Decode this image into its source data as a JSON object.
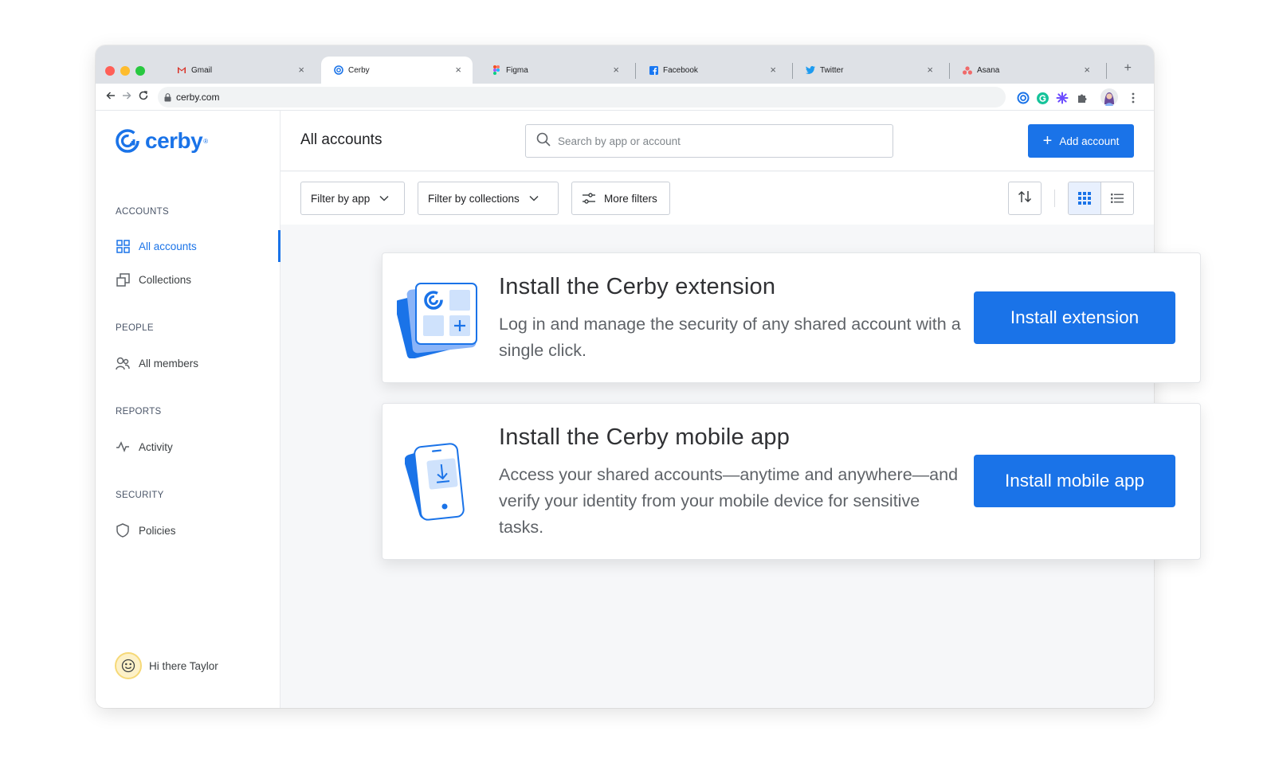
{
  "browser": {
    "tabs": [
      {
        "label": "Gmail",
        "icon": "gmail-icon"
      },
      {
        "label": "Cerby",
        "icon": "cerby-icon",
        "active": true
      },
      {
        "label": "Figma",
        "icon": "figma-icon"
      },
      {
        "label": "Facebook",
        "icon": "facebook-icon"
      },
      {
        "label": "Twitter",
        "icon": "twitter-icon"
      },
      {
        "label": "Asana",
        "icon": "asana-icon"
      }
    ],
    "tab_close": "×",
    "new_tab": "+",
    "url": "cerby.com"
  },
  "brand": {
    "name": "cerby",
    "reg": "®",
    "color": "#1a73e8"
  },
  "sidebar": {
    "sections": [
      {
        "title": "ACCOUNTS",
        "items": [
          {
            "label": "All accounts",
            "icon": "grid-icon",
            "active": true
          },
          {
            "label": "Collections",
            "icon": "collections-icon"
          }
        ]
      },
      {
        "title": "PEOPLE",
        "items": [
          {
            "label": "All members",
            "icon": "members-icon"
          }
        ]
      },
      {
        "title": "REPORTS",
        "items": [
          {
            "label": "Activity",
            "icon": "activity-icon"
          }
        ]
      },
      {
        "title": "SECURITY",
        "items": [
          {
            "label": "Policies",
            "icon": "shield-icon"
          }
        ]
      }
    ],
    "user_greeting": "Hi there Taylor"
  },
  "header": {
    "title": "All accounts",
    "search_placeholder": "Search by app or account",
    "add_button": "Add account"
  },
  "filters": {
    "filter_app": "Filter by app",
    "filter_collections": "Filter by collections",
    "more_filters": "More filters",
    "view_mode": "grid"
  },
  "cards": {
    "extension": {
      "title": "Install the Cerby extension",
      "body": "Log in and manage the security of any shared account with a single click.",
      "button": "Install extension"
    },
    "mobile": {
      "title": "Install the Cerby mobile app",
      "body": "Access your shared accounts—anytime and anywhere—and verify your identity from your mobile device for sensitive tasks.",
      "button": "Install mobile app"
    }
  }
}
